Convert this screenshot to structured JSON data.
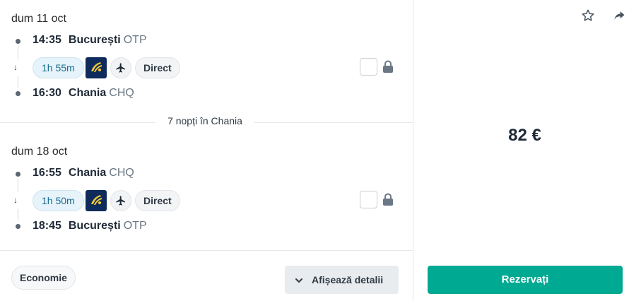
{
  "outbound": {
    "date": "dum 11 oct",
    "depart": {
      "time": "14:35",
      "city": "București",
      "code": "OTP"
    },
    "duration": "1h 55m",
    "stops": "Direct",
    "arrive": {
      "time": "16:30",
      "city": "Chania",
      "code": "CHQ"
    }
  },
  "stay": {
    "label": "7 nopți în Chania"
  },
  "inbound": {
    "date": "dum 18 oct",
    "depart": {
      "time": "16:55",
      "city": "Chania",
      "code": "CHQ"
    },
    "duration": "1h 50m",
    "stops": "Direct",
    "arrive": {
      "time": "18:45",
      "city": "București",
      "code": "OTP"
    }
  },
  "footer": {
    "cabin_label": "Economie",
    "details_label": "Afișează detalii"
  },
  "booking": {
    "price": "82 €",
    "book_label": "Rezervați"
  },
  "icons": {
    "favorite": "star-icon",
    "share": "share-icon",
    "airline": "ryanair-logo-icon",
    "plane": "airplane-icon",
    "lock": "lock-icon",
    "chevron": "chevron-down-icon"
  },
  "colors": {
    "accent": "#00a991",
    "duration_pill_bg": "#e6f3fa",
    "duration_pill_text": "#1a6c91",
    "airline_logo_bg": "#0f2b5b"
  }
}
